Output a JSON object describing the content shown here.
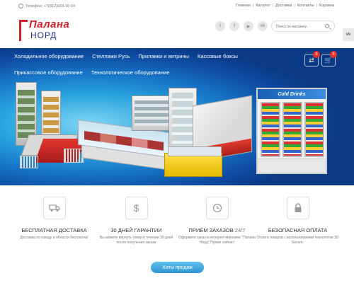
{
  "topbar": {
    "phone": "Телефон: +7(812)933-16-04",
    "links": [
      "Главная",
      "Каталог",
      "Доставка",
      "Контакты",
      "Корзина"
    ]
  },
  "logo": {
    "top": "Палана",
    "bottom": "НОРД"
  },
  "socials": [
    {
      "name": "twitter",
      "glyph": "t"
    },
    {
      "name": "facebook",
      "glyph": "f"
    },
    {
      "name": "youtube",
      "glyph": "▶"
    },
    {
      "name": "vk",
      "glyph": "vk"
    }
  ],
  "search": {
    "placeholder": "Поиск по магазину..."
  },
  "side_tab": "vk",
  "nav": {
    "row1": [
      "Холодильное оборудование",
      "Стеллажи Русь",
      "Прилавки и витрины",
      "Кассовые боксы"
    ],
    "row2": [
      "Прикассовое оборудование",
      "Технологическое оборудование"
    ]
  },
  "header_buttons": {
    "compare_count": "0",
    "cart_count": "0"
  },
  "hero": {
    "drinks_sign": "Cold Drinks"
  },
  "features": [
    {
      "icon": "truck-icon",
      "title": "БЕСПЛАТНАЯ ДОСТАВКА",
      "title_suffix": "",
      "text": "Доставка по городу и области бесплатна!"
    },
    {
      "icon": "dollar-icon",
      "title": "30 ДНЕЙ ГАРАНТИИ",
      "title_suffix": "",
      "text": "Вы можете вернуть товар в течении 30 дней после получения заказа"
    },
    {
      "icon": "clock-icon",
      "title": "ПРИЕМ ЗАКАЗОВ ",
      "title_suffix": "24/7",
      "text": "Оформите заказ в интернет-магазине \"Палана Норд\" Прямо сейчас!"
    },
    {
      "icon": "lock-icon",
      "title": "БЕЗОПАСНАЯ ОПЛАТА",
      "title_suffix": "",
      "text": "Оплата товаров с использованием технологии 3D Secure."
    }
  ],
  "hits_button": "Хиты продаж"
}
